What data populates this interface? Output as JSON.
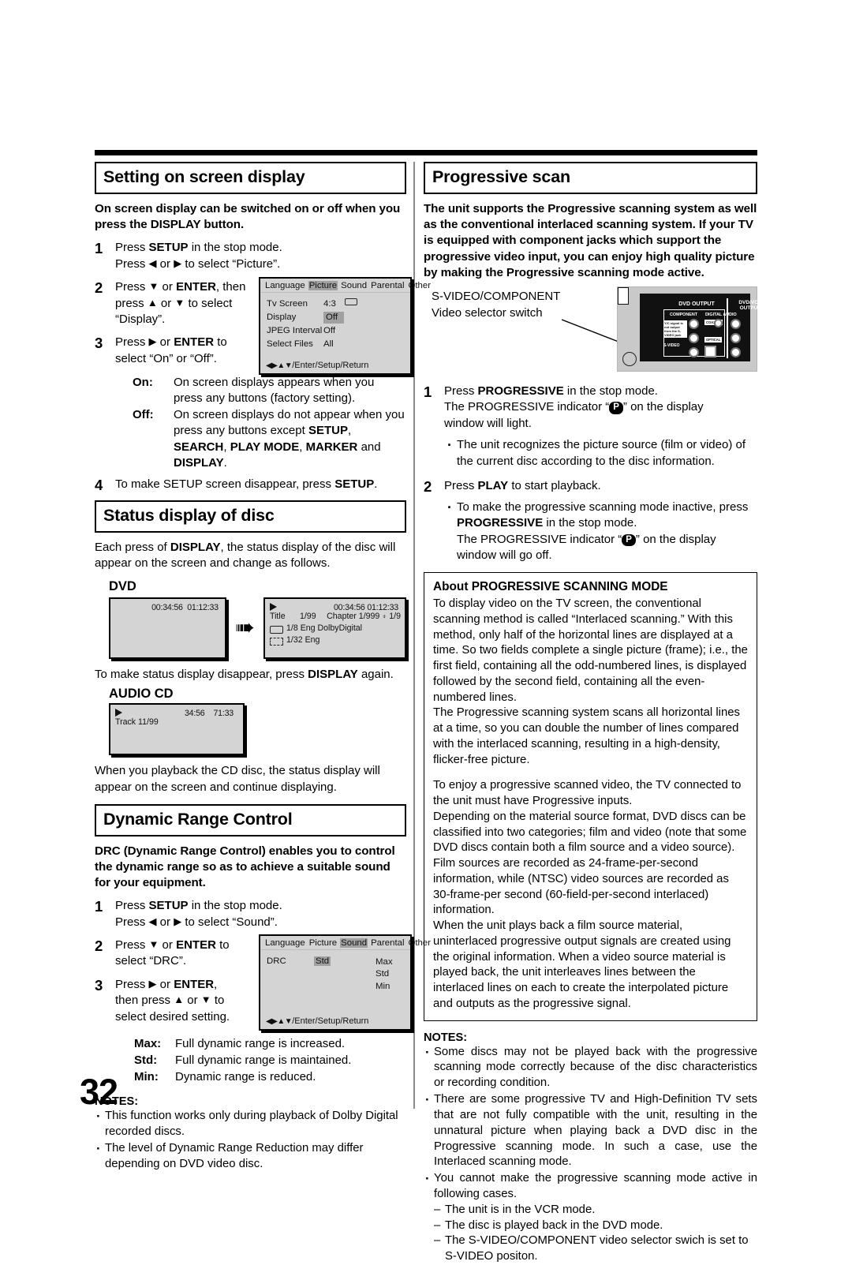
{
  "page": {
    "number": "32"
  },
  "left_column": {
    "section1": {
      "title": "Setting on screen display",
      "lead": "On screen display can be switched on or off when you press the DISPLAY button.",
      "steps": [
        {
          "num": "1",
          "line1_a": "Press ",
          "line1_b": "SETUP",
          "line1_c": " in the stop mode.",
          "line2_a": "Press ",
          "line2_b": " or ",
          "line2_c": " to select “Picture”."
        },
        {
          "num": "2",
          "l1a": "Press ",
          "l1b": " or ",
          "l1c": "ENTER",
          "l1d": ", then",
          "l2a": "press ",
          "l2b": " or ",
          "l2c": " to select",
          "l3": "“Display”."
        },
        {
          "num": "3",
          "l1a": "Press ",
          "l1b": " or ",
          "l1c": "ENTER",
          "l1d": " to",
          "l2": "select “On” or “Off”."
        },
        {
          "num": "4",
          "l1a": "To make SETUP screen disappear, press ",
          "l1b": "SETUP",
          "l1c": "."
        }
      ],
      "definitions": [
        {
          "term": "On:",
          "desc": "On screen displays appears when you press any buttons (factory setting)."
        },
        {
          "term": "Off:",
          "desc_a": "On screen displays do not appear when you press any buttons except ",
          "desc_b": "SETUP",
          "desc_c": ", ",
          "desc_d": "SEARCH",
          "desc_e": ", ",
          "desc_f": "PLAY MODE",
          "desc_g": ", ",
          "desc_h": "MARKER",
          "desc_i": " and ",
          "desc_j": "DISPLAY",
          "desc_k": "."
        }
      ],
      "osd_menu": {
        "tabs": [
          "Language",
          "Picture",
          "Sound",
          "Parental",
          "Other"
        ],
        "active_tab": "Picture",
        "rows": [
          {
            "key": "Tv Screen",
            "value": "4:3",
            "has_tv_icon": true,
            "highlight": false
          },
          {
            "key": "Display",
            "value": "Off",
            "highlight": true
          },
          {
            "key": "JPEG Interval",
            "value": "Off",
            "highlight": false
          },
          {
            "key": "Select Files",
            "value": "All",
            "highlight": false
          }
        ],
        "footer": "/Enter/Setup/Return"
      }
    },
    "section2": {
      "title": "Status display of disc",
      "intro_a": "Each press of ",
      "intro_b": "DISPLAY",
      "intro_c": ", the status display of the disc will appear on the screen and change as follows.",
      "dvd_label": "DVD",
      "dvd_box1": {
        "time_elapsed": "00:34:56",
        "time_total": "01:12:33"
      },
      "dvd_box2": {
        "time_elapsed": "00:34:56",
        "time_total": "01:12:33",
        "title_label": "Title",
        "title_value": "1/99",
        "chapter_label": "Chapter",
        "chapter_value": "1/999",
        "angle_value": "1/9",
        "audio_value": "1/8",
        "audio_lang": "Eng",
        "audio_format": "DolbyDigital",
        "subtitle_value": "1/32",
        "subtitle_lang": "Eng"
      },
      "after_dvd_a": "To make status display disappear, press ",
      "after_dvd_b": "DISPLAY",
      "after_dvd_c": " again.",
      "cd_label": "AUDIO CD",
      "cd_box": {
        "time_elapsed": "34:56",
        "time_total": "71:33",
        "track": "Track 11/99"
      },
      "after_cd": "When you playback the CD disc, the status display will appear on the screen and continue displaying."
    },
    "section3": {
      "title": "Dynamic Range Control",
      "lead": "DRC (Dynamic Range Control) enables you to control the dynamic range so as to achieve a suitable sound for your equipment.",
      "steps": [
        {
          "num": "1",
          "l1a": "Press ",
          "l1b": "SETUP",
          "l1c": " in the stop mode.",
          "l2a": "Press ",
          "l2b": " or ",
          "l2c": " to select “Sound”."
        },
        {
          "num": "2",
          "l1a": "Press ",
          "l1b": " or ",
          "l1c": "ENTER",
          "l1d": " to",
          "l2": "select “DRC”."
        },
        {
          "num": "3",
          "l1a": "Press ",
          "l1b": " or ",
          "l1c": "ENTER",
          "l1d": ",",
          "l2a": "then press ",
          "l2b": " or ",
          "l2c": " to",
          "l3": "select desired setting."
        }
      ],
      "osd_menu": {
        "tabs": [
          "Language",
          "Picture",
          "Sound",
          "Parental",
          "Other"
        ],
        "active_tab": "Sound",
        "row_key": "DRC",
        "row_value": "Std",
        "options": [
          "Max",
          "Std",
          "Min"
        ],
        "selected_option": "Std",
        "footer": "/Enter/Setup/Return"
      },
      "definitions": [
        {
          "term": "Max:",
          "desc": "Full dynamic range is increased."
        },
        {
          "term": "Std:",
          "desc": "Full dynamic range is maintained."
        },
        {
          "term": "Min:",
          "desc": "Dynamic range is reduced."
        }
      ],
      "notes_heading": "NOTES:",
      "notes": [
        "This function works only during playback of Dolby Digital recorded discs.",
        "The level of Dynamic Range Reduction may differ depending on DVD video disc."
      ]
    }
  },
  "right_column": {
    "section1": {
      "title": "Progressive scan",
      "lead": "The unit supports the Progressive scanning system as well as the conventional interlaced scanning system. If your TV is equipped with component jacks which support the progressive video input, you can enjoy high quality picture by making the Progressive scanning mode active.",
      "callout_line1": "S-VIDEO/COMPONENT",
      "callout_line2": "Video selector switch",
      "rear_panel": {
        "dvd_output": "DVD OUTPUT",
        "dvd_vcr_output": "DVD/VCR OUTPUT",
        "component": "COMPONENT",
        "digital_audio": "DIGITAL AUDIO",
        "s_video": "S-VIDEO",
        "coaxial": "COAXIAL",
        "optical": "OPTICAL",
        "note": "Y/C signal is not output from the S-VIDEO jack"
      },
      "steps": [
        {
          "num": "1",
          "l1a": "Press ",
          "l1b": "PROGRESSIVE",
          "l1c": " in the stop mode.",
          "l2a": "The PROGRESSIVE indicator “",
          "l2b": "P",
          "l2c": "” on the display",
          "l3": "window will light."
        },
        {
          "num": "2",
          "l1a": "Press ",
          "l1b": "PLAY",
          "l1c": " to start playback."
        }
      ],
      "bullet1": "The unit recognizes the picture source (film or video) of the current disc according to the disc information.",
      "bullet2_a": "To make the progressive scanning mode inactive, press ",
      "bullet2_b": "PROGRESSIVE",
      "bullet2_c": " in the stop mode.",
      "bullet2_d": "The PROGRESSIVE indicator “",
      "bullet2_e": "P",
      "bullet2_f": "” on the display",
      "bullet2_g": "window will go off."
    },
    "about_box": {
      "heading": "About PROGRESSIVE SCANNING MODE",
      "paragraph1": "To display video on the TV screen, the conventional scanning method is called “Interlaced scanning.” With this method, only half of the horizontal lines are displayed at a time. So two fields complete a single picture (frame); i.e., the first field, containing all the odd-numbered lines, is displayed followed by the second field, containing all the even-numbered lines.",
      "paragraph2": "The Progressive scanning system scans all horizontal lines at a time, so you can double the number of lines compared with the interlaced scanning, resulting in a high-density, flicker-free picture.",
      "paragraph3": "To enjoy a progressive scanned video, the TV connected to the unit must have Progressive inputs.",
      "paragraph4": "Depending on the material source format, DVD discs can be classified into two categories; film and video (note that some DVD discs contain both a film source and a video source). Film sources are recorded as 24-frame-per-second information, while (NTSC) video sources are recorded as 30-frame-per second (60-field-per-second interlaced) information.",
      "paragraph5": "When the unit plays back a film source material, uninterlaced progressive output signals are created using the original information. When a video source material is played back, the unit interleaves lines between the interlaced lines on each to create the interpolated picture and outputs as the progressive signal."
    },
    "notes": {
      "heading": "NOTES:",
      "items": [
        "Some discs may not be played back with the progressive scanning mode correctly because of the disc characteristics or recording condition.",
        "There are some progressive TV and High-Definition TV sets that are not fully compatible with the unit, resulting in the unnatural picture when playing back a DVD disc in the Progressive scanning mode. In such a case, use the Interlaced scanning mode.",
        "You cannot make the progressive scanning mode active in following cases."
      ],
      "subitems": [
        "The unit is in the VCR mode.",
        "The disc is played back in the DVD mode.",
        "The S-VIDEO/COMPONENT video selector swich is set to S-VIDEO positon."
      ]
    }
  }
}
